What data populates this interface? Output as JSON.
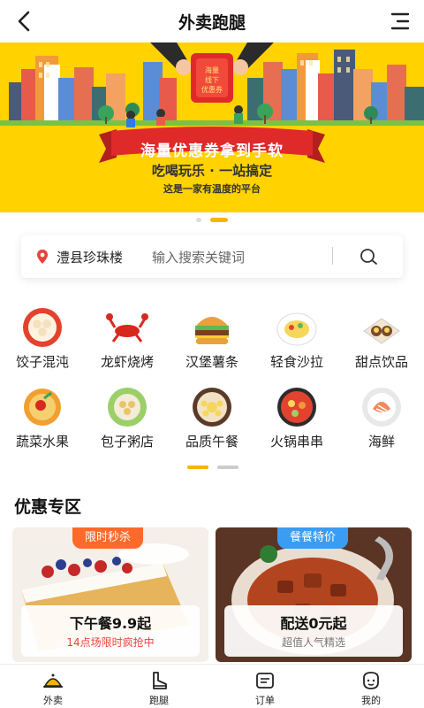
{
  "header": {
    "title": "外卖跑腿"
  },
  "banner": {
    "coupon_text": "海量\n线下\n优惠券",
    "ribbon": "海量优惠券拿到手软",
    "slogan": "吃喝玩乐 · 一站搞定",
    "sub_slogan": "这是一家有温度的平台"
  },
  "search": {
    "location": "澧县珍珠楼",
    "placeholder": "输入搜索关键词"
  },
  "categories": [
    {
      "label": "饺子混沌",
      "icon": "dumpling-icon"
    },
    {
      "label": "龙虾烧烤",
      "icon": "lobster-icon"
    },
    {
      "label": "汉堡薯条",
      "icon": "burger-icon"
    },
    {
      "label": "轻食沙拉",
      "icon": "salad-icon"
    },
    {
      "label": "甜点饮品",
      "icon": "dessert-icon"
    },
    {
      "label": "蔬菜水果",
      "icon": "fruit-icon"
    },
    {
      "label": "包子粥店",
      "icon": "bun-icon"
    },
    {
      "label": "品质午餐",
      "icon": "lunch-icon"
    },
    {
      "label": "火锅串串",
      "icon": "hotpot-icon"
    },
    {
      "label": "海鲜",
      "icon": "seafood-icon"
    }
  ],
  "promo": {
    "title": "优惠专区",
    "cards": [
      {
        "tag": "限时秒杀",
        "headline": "下午餐9.9起",
        "sub": "14点场限时疯抢中"
      },
      {
        "tag": "餐餐特价",
        "headline": "配送0元起",
        "sub": "超值人气精选"
      }
    ]
  },
  "nav": [
    {
      "label": "外卖",
      "icon": "takeout-icon"
    },
    {
      "label": "跑腿",
      "icon": "errand-icon"
    },
    {
      "label": "订单",
      "icon": "order-icon"
    },
    {
      "label": "我的",
      "icon": "profile-icon"
    }
  ],
  "colors": {
    "accent": "#f5b400",
    "banner_bg": "#ffd200",
    "ribbon_red": "#e02a2a",
    "tag_orange": "#ff6a2a",
    "tag_blue": "#3a9cf2",
    "promo_sub_red": "#e9443a"
  }
}
